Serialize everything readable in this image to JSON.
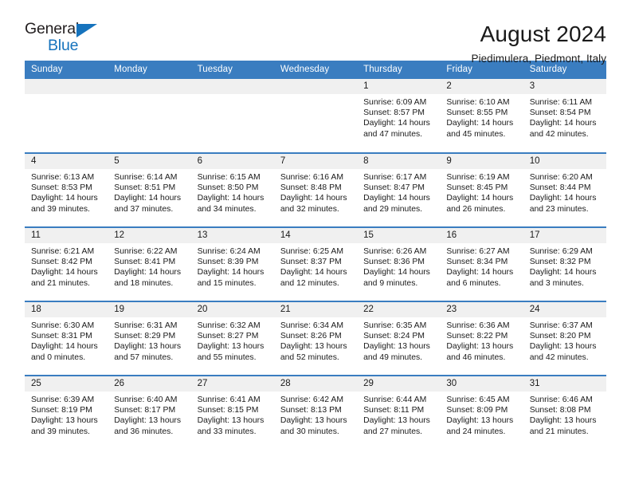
{
  "brand": {
    "name_part1": "General",
    "name_part2": "Blue",
    "accent_color": "#1673bd"
  },
  "header": {
    "title": "August 2024",
    "subtitle": "Piedimulera, Piedmont, Italy"
  },
  "calendar": {
    "header_bg": "#3a7dc0",
    "daynum_bg": "#f0f0f0",
    "weekdays": [
      "Sunday",
      "Monday",
      "Tuesday",
      "Wednesday",
      "Thursday",
      "Friday",
      "Saturday"
    ],
    "labels": {
      "sunrise": "Sunrise:",
      "sunset": "Sunset:",
      "daylight": "Daylight:"
    },
    "weeks": [
      [
        {
          "day": "",
          "empty": true
        },
        {
          "day": "",
          "empty": true
        },
        {
          "day": "",
          "empty": true
        },
        {
          "day": "",
          "empty": true
        },
        {
          "day": "1",
          "sunrise": "Sunrise: 6:09 AM",
          "sunset": "Sunset: 8:57 PM",
          "daylight_line1": "Daylight: 14 hours",
          "daylight_line2": "and 47 minutes."
        },
        {
          "day": "2",
          "sunrise": "Sunrise: 6:10 AM",
          "sunset": "Sunset: 8:55 PM",
          "daylight_line1": "Daylight: 14 hours",
          "daylight_line2": "and 45 minutes."
        },
        {
          "day": "3",
          "sunrise": "Sunrise: 6:11 AM",
          "sunset": "Sunset: 8:54 PM",
          "daylight_line1": "Daylight: 14 hours",
          "daylight_line2": "and 42 minutes."
        }
      ],
      [
        {
          "day": "4",
          "sunrise": "Sunrise: 6:13 AM",
          "sunset": "Sunset: 8:53 PM",
          "daylight_line1": "Daylight: 14 hours",
          "daylight_line2": "and 39 minutes."
        },
        {
          "day": "5",
          "sunrise": "Sunrise: 6:14 AM",
          "sunset": "Sunset: 8:51 PM",
          "daylight_line1": "Daylight: 14 hours",
          "daylight_line2": "and 37 minutes."
        },
        {
          "day": "6",
          "sunrise": "Sunrise: 6:15 AM",
          "sunset": "Sunset: 8:50 PM",
          "daylight_line1": "Daylight: 14 hours",
          "daylight_line2": "and 34 minutes."
        },
        {
          "day": "7",
          "sunrise": "Sunrise: 6:16 AM",
          "sunset": "Sunset: 8:48 PM",
          "daylight_line1": "Daylight: 14 hours",
          "daylight_line2": "and 32 minutes."
        },
        {
          "day": "8",
          "sunrise": "Sunrise: 6:17 AM",
          "sunset": "Sunset: 8:47 PM",
          "daylight_line1": "Daylight: 14 hours",
          "daylight_line2": "and 29 minutes."
        },
        {
          "day": "9",
          "sunrise": "Sunrise: 6:19 AM",
          "sunset": "Sunset: 8:45 PM",
          "daylight_line1": "Daylight: 14 hours",
          "daylight_line2": "and 26 minutes."
        },
        {
          "day": "10",
          "sunrise": "Sunrise: 6:20 AM",
          "sunset": "Sunset: 8:44 PM",
          "daylight_line1": "Daylight: 14 hours",
          "daylight_line2": "and 23 minutes."
        }
      ],
      [
        {
          "day": "11",
          "sunrise": "Sunrise: 6:21 AM",
          "sunset": "Sunset: 8:42 PM",
          "daylight_line1": "Daylight: 14 hours",
          "daylight_line2": "and 21 minutes."
        },
        {
          "day": "12",
          "sunrise": "Sunrise: 6:22 AM",
          "sunset": "Sunset: 8:41 PM",
          "daylight_line1": "Daylight: 14 hours",
          "daylight_line2": "and 18 minutes."
        },
        {
          "day": "13",
          "sunrise": "Sunrise: 6:24 AM",
          "sunset": "Sunset: 8:39 PM",
          "daylight_line1": "Daylight: 14 hours",
          "daylight_line2": "and 15 minutes."
        },
        {
          "day": "14",
          "sunrise": "Sunrise: 6:25 AM",
          "sunset": "Sunset: 8:37 PM",
          "daylight_line1": "Daylight: 14 hours",
          "daylight_line2": "and 12 minutes."
        },
        {
          "day": "15",
          "sunrise": "Sunrise: 6:26 AM",
          "sunset": "Sunset: 8:36 PM",
          "daylight_line1": "Daylight: 14 hours",
          "daylight_line2": "and 9 minutes."
        },
        {
          "day": "16",
          "sunrise": "Sunrise: 6:27 AM",
          "sunset": "Sunset: 8:34 PM",
          "daylight_line1": "Daylight: 14 hours",
          "daylight_line2": "and 6 minutes."
        },
        {
          "day": "17",
          "sunrise": "Sunrise: 6:29 AM",
          "sunset": "Sunset: 8:32 PM",
          "daylight_line1": "Daylight: 14 hours",
          "daylight_line2": "and 3 minutes."
        }
      ],
      [
        {
          "day": "18",
          "sunrise": "Sunrise: 6:30 AM",
          "sunset": "Sunset: 8:31 PM",
          "daylight_line1": "Daylight: 14 hours",
          "daylight_line2": "and 0 minutes."
        },
        {
          "day": "19",
          "sunrise": "Sunrise: 6:31 AM",
          "sunset": "Sunset: 8:29 PM",
          "daylight_line1": "Daylight: 13 hours",
          "daylight_line2": "and 57 minutes."
        },
        {
          "day": "20",
          "sunrise": "Sunrise: 6:32 AM",
          "sunset": "Sunset: 8:27 PM",
          "daylight_line1": "Daylight: 13 hours",
          "daylight_line2": "and 55 minutes."
        },
        {
          "day": "21",
          "sunrise": "Sunrise: 6:34 AM",
          "sunset": "Sunset: 8:26 PM",
          "daylight_line1": "Daylight: 13 hours",
          "daylight_line2": "and 52 minutes."
        },
        {
          "day": "22",
          "sunrise": "Sunrise: 6:35 AM",
          "sunset": "Sunset: 8:24 PM",
          "daylight_line1": "Daylight: 13 hours",
          "daylight_line2": "and 49 minutes."
        },
        {
          "day": "23",
          "sunrise": "Sunrise: 6:36 AM",
          "sunset": "Sunset: 8:22 PM",
          "daylight_line1": "Daylight: 13 hours",
          "daylight_line2": "and 46 minutes."
        },
        {
          "day": "24",
          "sunrise": "Sunrise: 6:37 AM",
          "sunset": "Sunset: 8:20 PM",
          "daylight_line1": "Daylight: 13 hours",
          "daylight_line2": "and 42 minutes."
        }
      ],
      [
        {
          "day": "25",
          "sunrise": "Sunrise: 6:39 AM",
          "sunset": "Sunset: 8:19 PM",
          "daylight_line1": "Daylight: 13 hours",
          "daylight_line2": "and 39 minutes."
        },
        {
          "day": "26",
          "sunrise": "Sunrise: 6:40 AM",
          "sunset": "Sunset: 8:17 PM",
          "daylight_line1": "Daylight: 13 hours",
          "daylight_line2": "and 36 minutes."
        },
        {
          "day": "27",
          "sunrise": "Sunrise: 6:41 AM",
          "sunset": "Sunset: 8:15 PM",
          "daylight_line1": "Daylight: 13 hours",
          "daylight_line2": "and 33 minutes."
        },
        {
          "day": "28",
          "sunrise": "Sunrise: 6:42 AM",
          "sunset": "Sunset: 8:13 PM",
          "daylight_line1": "Daylight: 13 hours",
          "daylight_line2": "and 30 minutes."
        },
        {
          "day": "29",
          "sunrise": "Sunrise: 6:44 AM",
          "sunset": "Sunset: 8:11 PM",
          "daylight_line1": "Daylight: 13 hours",
          "daylight_line2": "and 27 minutes."
        },
        {
          "day": "30",
          "sunrise": "Sunrise: 6:45 AM",
          "sunset": "Sunset: 8:09 PM",
          "daylight_line1": "Daylight: 13 hours",
          "daylight_line2": "and 24 minutes."
        },
        {
          "day": "31",
          "sunrise": "Sunrise: 6:46 AM",
          "sunset": "Sunset: 8:08 PM",
          "daylight_line1": "Daylight: 13 hours",
          "daylight_line2": "and 21 minutes."
        }
      ]
    ]
  }
}
